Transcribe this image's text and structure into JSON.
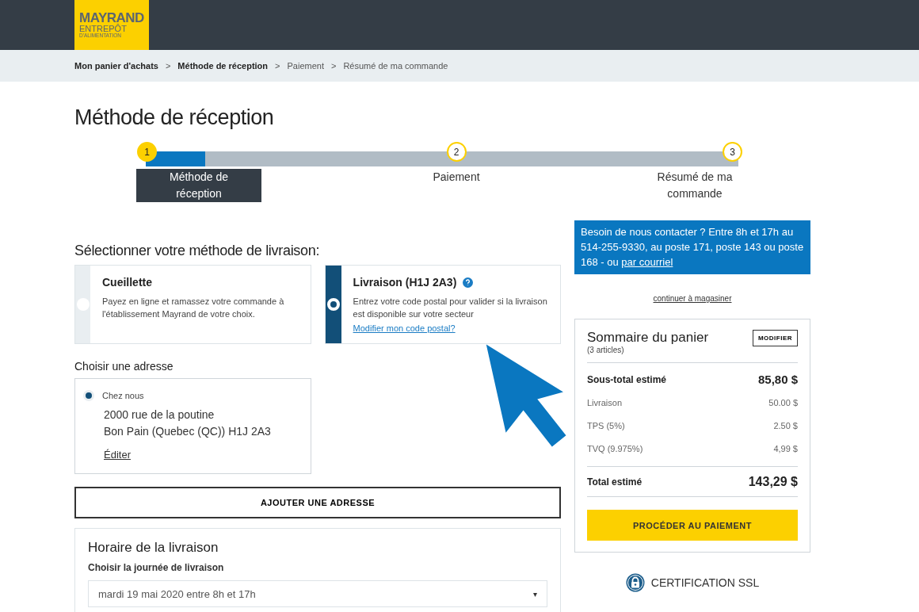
{
  "logo": {
    "name": "MAYRAND",
    "line_2": "ENTREPÔT",
    "line_3": "D'ALIMENTATION"
  },
  "breadcrumb": [
    {
      "label": "Mon panier d'achats",
      "visited": true
    },
    {
      "label": "Méthode de réception",
      "visited": true
    },
    {
      "label": "Paiement",
      "visited": false
    },
    {
      "label": "Résumé de ma commande",
      "visited": false
    }
  ],
  "separator": ">",
  "title": "Méthode de réception",
  "stepper": {
    "level": 0.1,
    "steps": [
      {
        "number": "1",
        "label": "Méthode de réception",
        "selected": true
      },
      {
        "number": "2",
        "label": "Paiement",
        "selected": false
      },
      {
        "number": "3",
        "label": "Résumé de ma commande",
        "selected": false
      }
    ]
  },
  "delivery": {
    "heading": "Sélectionner votre méthode de livraison:",
    "options": [
      {
        "title": "Cueillette",
        "description": "Payez en ligne et ramassez votre commande à l'établissement Mayrand de votre choix.",
        "selected": false
      },
      {
        "title": "Livraison (H1J 2A3)",
        "description": "Entrez votre code postal pour valider si la livraison est disponible sur votre secteur",
        "link": "Modifier mon code postal?",
        "help": true,
        "selected": true
      }
    ]
  },
  "address": {
    "heading": "Choisir une adresse",
    "name": "Chez nous",
    "line_1": "2000 rue de la poutine",
    "line_2": "Bon Pain (Quebec (QC)) H1J 2A3",
    "edit": "Éditer",
    "selected": true
  },
  "add_address": "AJOUTER UNE ADRESSE",
  "schedule": {
    "heading": "Horaire de la livraison",
    "label": "Choisir la journée de livraison",
    "value": "mardi 19 mai 2020 entre 8h et 17h",
    "caret": "▾"
  },
  "contact": {
    "text": "Besoin de nous contacter ? Entre 8h et 17h au 514-255-9330, au poste 171, poste 143 ou poste 168 - ou",
    "link": "par courriel"
  },
  "continue_link": "continuer à magasiner",
  "summary": {
    "title": "Sommaire du panier",
    "count": "(3 articles)",
    "edit": "MODIFIER",
    "rows": [
      {
        "label": "Sous-total estimé",
        "value": "85,80 $",
        "kind": "major"
      },
      {
        "label": "Livraison",
        "value": "50.00 $",
        "kind": "minor"
      },
      {
        "label": "TPS (5%)",
        "value": "2.50 $",
        "kind": "minor"
      },
      {
        "label": "TVQ (9.975%)",
        "value": "4,99 $",
        "kind": "minor"
      },
      {
        "label": "Total estimé",
        "value": "143,29 $",
        "kind": "total"
      }
    ],
    "checkout": "PROCÉDER AU PAIEMENT"
  },
  "ssl": "CERTIFICATION SSL"
}
